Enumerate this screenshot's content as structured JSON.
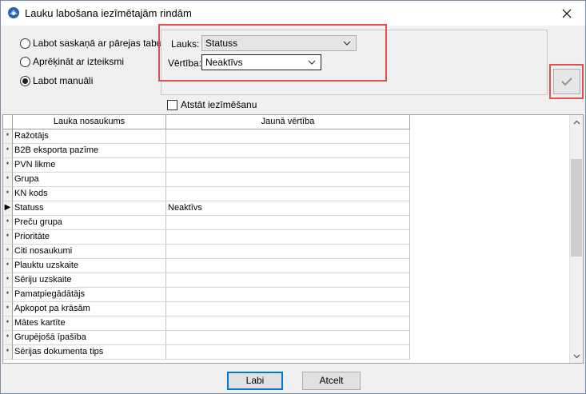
{
  "window": {
    "title": "Lauku labošana iezīmētajām rindām"
  },
  "mode_options": [
    {
      "label": "Labot saskaņā ar pārejas tabulu",
      "selected": false
    },
    {
      "label": "Aprēķināt ar izteiksmi",
      "selected": false
    },
    {
      "label": "Labot manuāli",
      "selected": true
    }
  ],
  "fields": {
    "lauks_label": "Lauks:",
    "lauks_value": "Statuss",
    "vertiba_label": "Vērtība:",
    "vertiba_value": "Neaktīvs"
  },
  "keep_selection": {
    "label": "Atstāt iezīmēšanu",
    "checked": false
  },
  "grid": {
    "columns": [
      "Lauka nosaukums",
      "Jaunā vērtība"
    ],
    "rows": [
      {
        "indicator": "*",
        "name": "Ražotājs",
        "value": ""
      },
      {
        "indicator": "*",
        "name": "B2B eksporta pazīme",
        "value": ""
      },
      {
        "indicator": "*",
        "name": "PVN likme",
        "value": ""
      },
      {
        "indicator": "*",
        "name": "Grupa",
        "value": ""
      },
      {
        "indicator": "*",
        "name": "KN kods",
        "value": ""
      },
      {
        "indicator": "▶",
        "name": "Statuss",
        "value": "Neaktīvs"
      },
      {
        "indicator": "*",
        "name": "Preču grupa",
        "value": ""
      },
      {
        "indicator": "*",
        "name": "Prioritāte",
        "value": ""
      },
      {
        "indicator": "*",
        "name": "Citi nosaukumi",
        "value": ""
      },
      {
        "indicator": "*",
        "name": "Plauktu uzskaite",
        "value": ""
      },
      {
        "indicator": "*",
        "name": "Sēriju uzskaite",
        "value": ""
      },
      {
        "indicator": "*",
        "name": "Pamatpiegādātājs",
        "value": ""
      },
      {
        "indicator": "*",
        "name": "Apkopot pa krāsām",
        "value": ""
      },
      {
        "indicator": "*",
        "name": "Mātes kartīte",
        "value": ""
      },
      {
        "indicator": "*",
        "name": "Grupējošā īpašība",
        "value": ""
      },
      {
        "indicator": "*",
        "name": "Sērijas dokumenta tips",
        "value": ""
      }
    ]
  },
  "buttons": {
    "ok": "Labi",
    "cancel": "Atcelt"
  },
  "colors": {
    "highlight": "#e05050",
    "current_row_marker": "#000000"
  }
}
